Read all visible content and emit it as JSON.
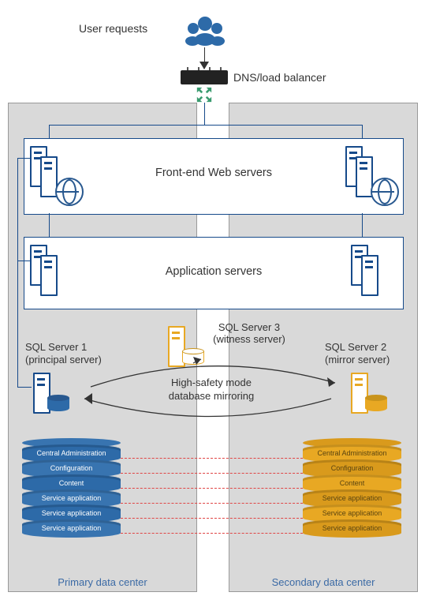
{
  "header": {
    "user_requests": "User requests",
    "dns_lb": "DNS/load balancer"
  },
  "tiers": {
    "frontend": "Front-end Web servers",
    "application": "Application servers"
  },
  "sql": {
    "server1_title": "SQL Server 1",
    "server1_sub": "(principal server)",
    "server2_title": "SQL Server 2",
    "server2_sub": "(mirror server)",
    "server3_title": "SQL Server 3",
    "server3_sub": "(witness server)",
    "mirroring_l1": "High-safety mode",
    "mirroring_l2": "database mirroring"
  },
  "datacenters": {
    "primary": "Primary data center",
    "secondary": "Secondary data center"
  },
  "db_layers": [
    "Central Administration",
    "Configuration",
    "Content",
    "Service application",
    "Service application",
    "Service application"
  ]
}
